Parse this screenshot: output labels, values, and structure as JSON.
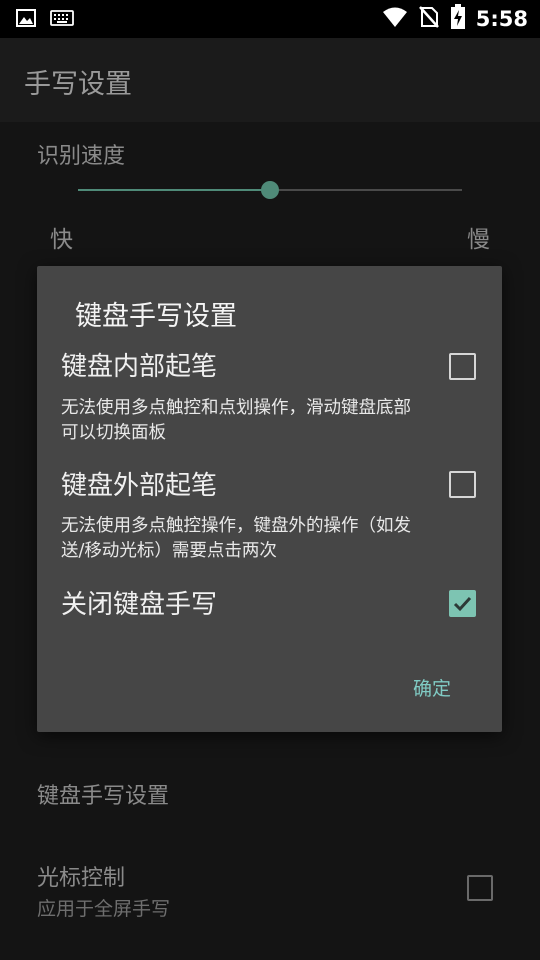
{
  "status_bar": {
    "time": "5:58",
    "left_icons": [
      "image-icon",
      "keyboard-icon"
    ],
    "right_icons": [
      "wifi-icon",
      "no-sim-icon",
      "battery-charging-icon"
    ]
  },
  "app": {
    "title": "手写设置"
  },
  "recognition_speed": {
    "label": "识别速度",
    "fast_label": "快",
    "slow_label": "慢",
    "value_fraction": 0.5,
    "accent": "#4f8a78"
  },
  "dialog": {
    "title": "键盘手写设置",
    "options": [
      {
        "title": "键盘内部起笔",
        "description": "无法使用多点触控和点划操作，滑动键盘底部可以切换面板",
        "checked": false
      },
      {
        "title": "键盘外部起笔",
        "description": "无法使用多点触控操作，键盘外的操作（如发送/移动光标）需要点击两次",
        "checked": false
      },
      {
        "title": "关闭键盘手写",
        "description": "",
        "checked": true
      }
    ],
    "ok_label": "确定",
    "accent": "#80cbc4"
  },
  "settings": {
    "keyboard_handwriting_label": "键盘手写设置",
    "cursor_control": {
      "title": "光标控制",
      "subtitle": "应用于全屏手写",
      "checked": false
    }
  }
}
